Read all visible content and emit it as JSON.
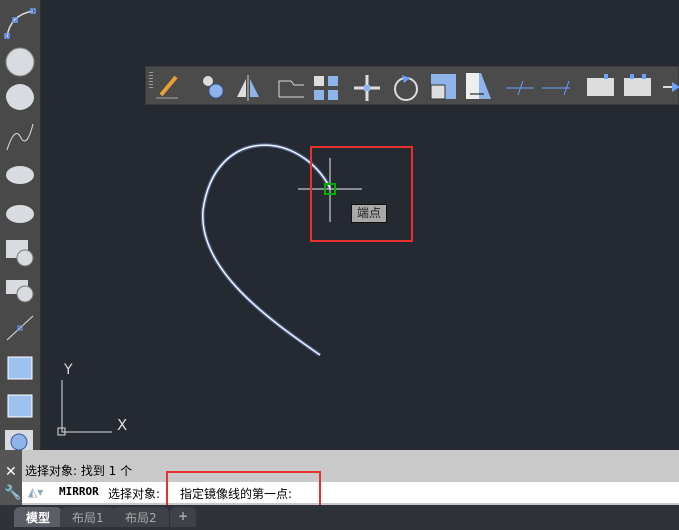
{
  "drawing": {
    "tooltip": "端点",
    "ucs_x": "X",
    "ucs_y": "Y"
  },
  "command": {
    "history": "选择对象: 找到 1 个",
    "command_name": "MIRROR",
    "prompt": "选择对象:",
    "current_prompt": "指定镜像线的第一点:"
  },
  "tabs": [
    {
      "label": "模型"
    },
    {
      "label": "布局1"
    },
    {
      "label": "布局2"
    },
    {
      "label": "+"
    }
  ],
  "colors": {
    "canvas": "#242932",
    "highlight": "#e8302f",
    "snap": "#00b000"
  }
}
